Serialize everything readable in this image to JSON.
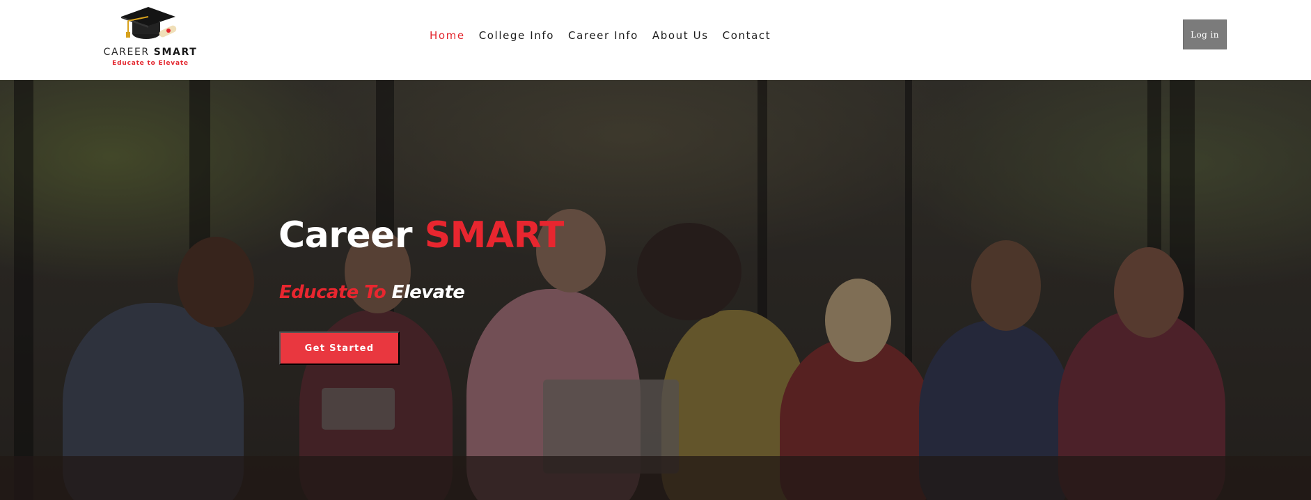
{
  "logo": {
    "name_regular": "CAREER ",
    "name_bold": "SMART",
    "tagline": "Educate to Elevate",
    "icon": "graduation-cap-icon"
  },
  "nav": {
    "items": [
      {
        "label": "Home",
        "active": true
      },
      {
        "label": "College Info",
        "active": false
      },
      {
        "label": "Career Info",
        "active": false
      },
      {
        "label": "About Us",
        "active": false
      },
      {
        "label": "Contact",
        "active": false
      }
    ]
  },
  "header": {
    "login_label": "Log in"
  },
  "hero": {
    "title_plain": "Career ",
    "title_accent": "SMART",
    "tagline_red": "Educate To ",
    "tagline_white": "Elevate",
    "cta_label": "Get Started",
    "background": "group-of-students-photo"
  },
  "colors": {
    "accent": "#e8262f",
    "button": "#e9373f",
    "login_bg": "#7b7b7b",
    "nav_text": "#1c1c1c"
  }
}
